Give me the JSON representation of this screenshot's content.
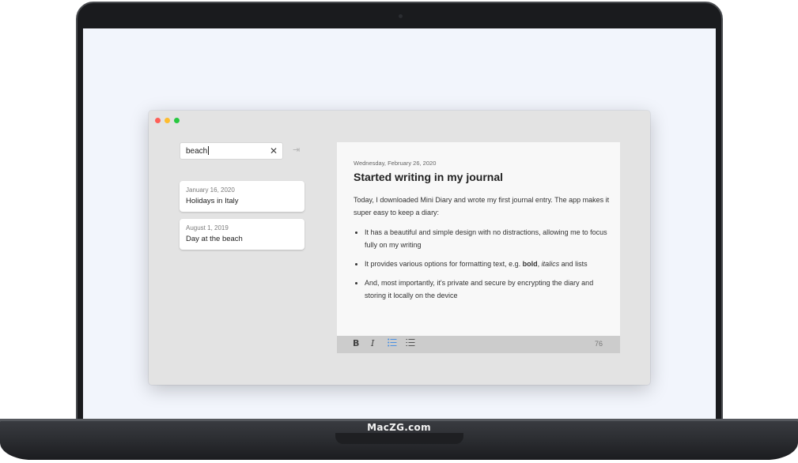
{
  "brand": "MacZG.com",
  "search": {
    "value": "beach",
    "clear_icon": "close-icon",
    "collapse_icon": "collapse-sidebar-icon"
  },
  "entries": [
    {
      "date": "January 16, 2020",
      "title": "Holidays in Italy"
    },
    {
      "date": "August 1, 2019",
      "title": "Day at the beach"
    }
  ],
  "editor": {
    "date": "Wednesday, February 26, 2020",
    "title": "Started writing in my journal",
    "intro": "Today, I downloaded Mini Diary and wrote my first journal entry. The app makes it super easy to keep a diary:",
    "bullets": [
      "It has a beautiful and simple design with no distractions, allowing me to focus fully on my writing",
      {
        "before": "It provides various options for formatting text, e.g. ",
        "bold": "bold",
        "sep": ", ",
        "italic": "italics",
        "after": " and lists"
      },
      "And, most importantly, it's private and secure by encrypting the diary and storing it locally on the device"
    ]
  },
  "toolbar": {
    "bold_label": "B",
    "italic_label": "I",
    "word_count": "76",
    "accent_color": "#4a90e2"
  },
  "colors": {
    "red": "#fe5f57",
    "yellow": "#febc2e",
    "green": "#28c840"
  }
}
